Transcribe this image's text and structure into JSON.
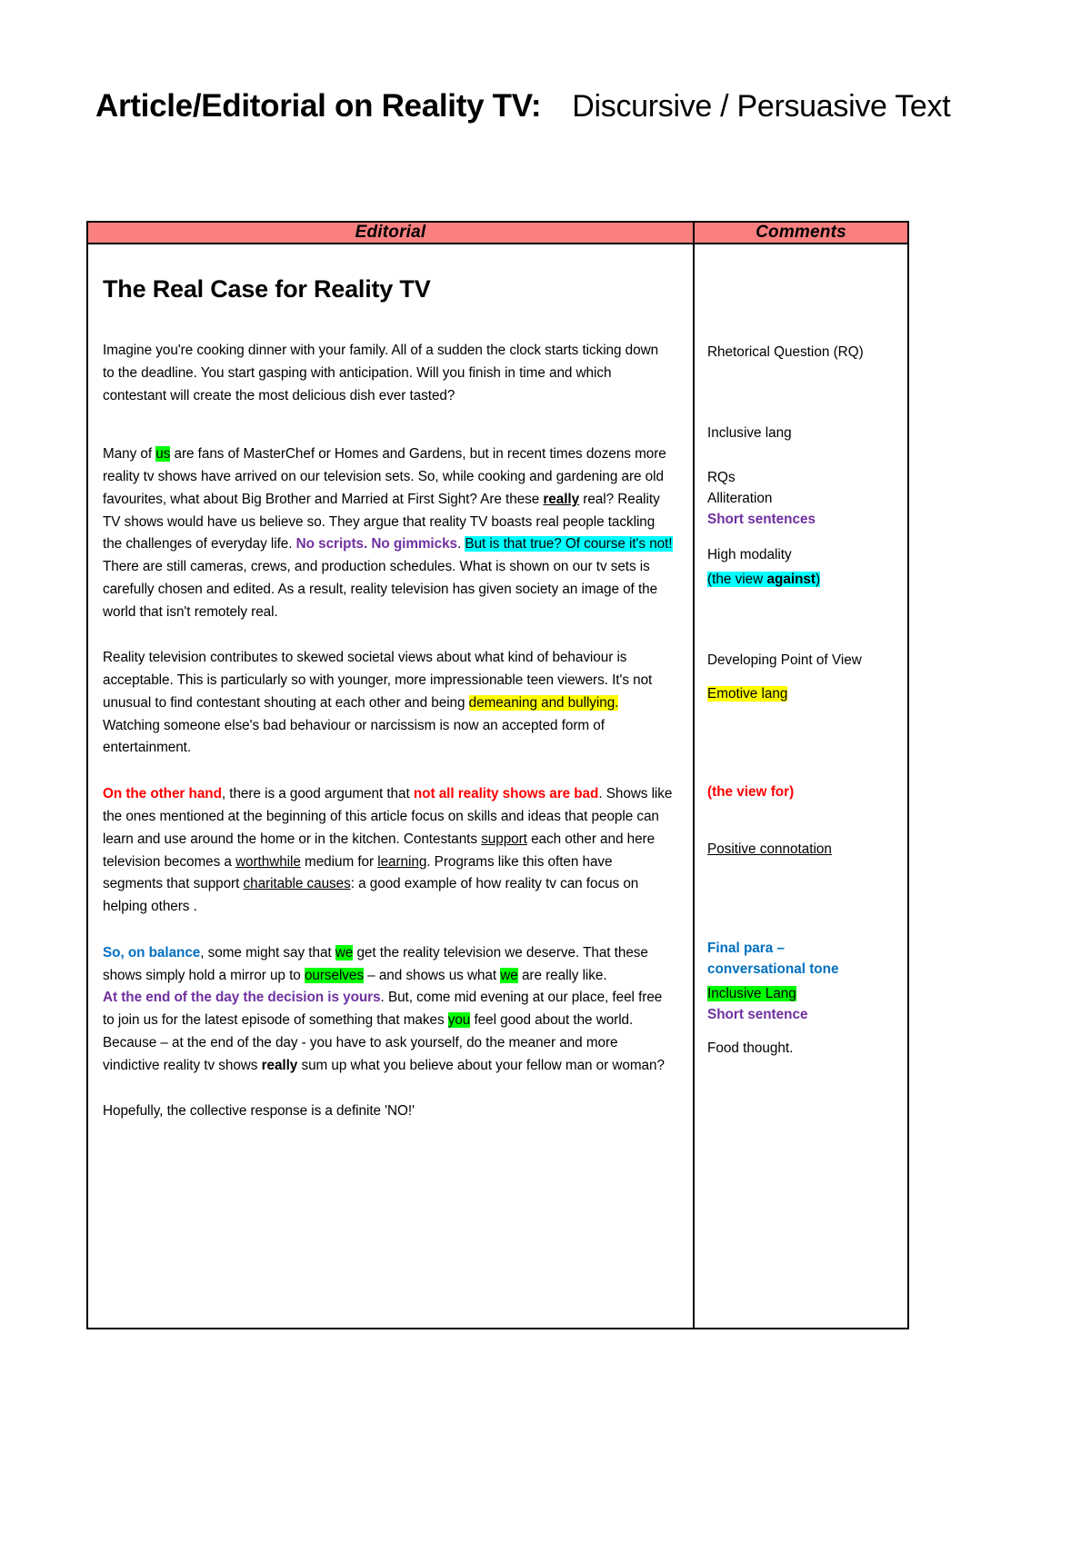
{
  "title": {
    "bold_part": "Article/Editorial on Reality TV:",
    "light_part": "Discursive / Persuasive Text"
  },
  "table": {
    "headers": {
      "editorial": "Editorial",
      "comments": "Comments"
    }
  },
  "editorial": {
    "heading": "The Real Case for Reality TV",
    "p1": "Imagine you're cooking dinner with your family.  All of a sudden the clock starts ticking down to the deadline. You start gasping with anticipation. Will you finish in time and which contestant will create the most delicious dish ever tasted?",
    "p2": {
      "s1": "Many of ",
      "hl_us": "us",
      "s2": " are fans of MasterChef or Homes and Gardens, but in recent times dozens more reality tv shows have arrived on our television sets.  So, while cooking and gardening are old favourites, what about Big Brother and Married at First Sight?  Are these ",
      "bu_really": "really",
      "s3": " real?  Reality TV shows would have us believe so. They argue that reality TV boasts real people tackling the challenges of everyday life. ",
      "purple_noscripts": "No scripts.  No gimmicks",
      "s4": ". ",
      "cyan_claim": "But is that true? Of course it's not!",
      "s5": " There are still cameras, crews, and production schedules.  What is shown on our tv sets is carefully chosen and edited.  As a result, reality television has given society an image of the world that isn't remotely real."
    },
    "p3": {
      "s1": "Reality television contributes to skewed societal views about what kind of behaviour is acceptable.  This is particularly so with younger, more impressionable teen viewers.  It's not unusual to find contestant shouting at each other and being ",
      "hl_demeaning": "demeaning and bullying.",
      "s2": "  Watching someone else's bad behaviour or narcissism is now an accepted form of entertainment."
    },
    "p4": {
      "red_otherhand": "On the other hand",
      "s1": ", there is a good argument that ",
      "red_notall": "not all reality shows are bad",
      "s2": ".  Shows like the ones mentioned at the beginning of this article focus on skills and ideas that people can learn and use around the home or in the kitchen.  Contestants ",
      "u_support": "support",
      "s3": " each other and here television becomes a ",
      "u_worthwhile": "worthwhile",
      "s4": " medium for ",
      "u_learning": "learning",
      "s5": ".  Programs like this often have segments that support ",
      "u_charitable": "charitable causes",
      "s6": ":  a good example of how reality tv can focus on helping others ."
    },
    "p5": {
      "blue_sobalance": "So, on balance",
      "s1": ", some might say that ",
      "hl_we1": "we",
      "s2": " get the reality television we deserve.  That these shows simply hold a mirror up to ",
      "hl_ourselves": "ourselves",
      "s3": " – and shows us what ",
      "hl_we2": "we",
      "s4": " are really like."
    },
    "p6": {
      "purple_endofday": "At the end of the day the decision is yours",
      "s1": ".  But, come mid evening at our place, feel free to join us for the latest episode of  something that makes ",
      "hl_you": "you",
      "s2": " feel good about the world.  Because – at the end of the day - you have to ask yourself, do the meaner and more vindictive reality tv shows ",
      "bold_really": "really",
      "s3": " sum up what you believe about your fellow man or woman?"
    },
    "p7": "Hopefully, the collective response is a definite 'NO!'"
  },
  "comments": {
    "c1": "Rhetorical Question (RQ)",
    "c2": "Inclusive lang",
    "c3": "RQs",
    "c4": "Alliteration",
    "c5_purple": "Short sentences",
    "c6": "High modality",
    "c7_cyan_prefix": "(the view ",
    "c7_cyan_bold": "against",
    "c7_cyan_suffix": ")",
    "c8": "Developing Point of View",
    "c9_yellow": "Emotive lang",
    "c10_red": "(the view for)",
    "c11_under": "Positive connotation",
    "c12_blue_line1": "Final para –",
    "c12_blue_line2": "conversational tone",
    "c13_green": "Inclusive Lang",
    "c14_purple": "Short sentence",
    "c15": "Food thought."
  },
  "colors": {
    "header_fill": "#FA7F7F",
    "highlight_green": "#00FF00",
    "highlight_yellow": "#FFFF00",
    "highlight_cyan": "#00FFFF",
    "text_purple": "#7030A0",
    "text_red": "#FF0000",
    "text_blue": "#0070C0"
  }
}
